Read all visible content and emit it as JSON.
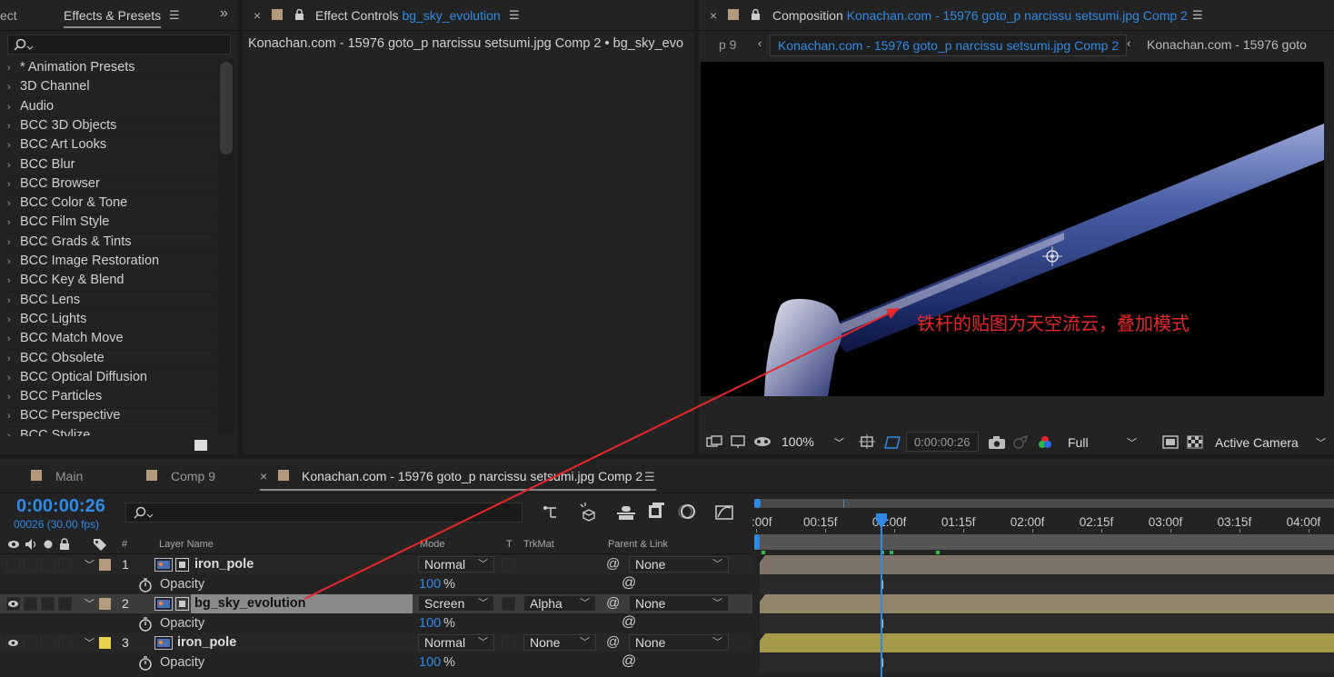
{
  "effects_panel": {
    "clipped_tab": "ect",
    "tab_title": "Effects & Presets",
    "search_placeholder": "",
    "items": [
      "* Animation Presets",
      "3D Channel",
      "Audio",
      "BCC 3D Objects",
      "BCC Art Looks",
      "BCC Blur",
      "BCC Browser",
      "BCC Color & Tone",
      "BCC Film Style",
      "BCC Grads & Tints",
      "BCC Image Restoration",
      "BCC Key & Blend",
      "BCC Lens",
      "BCC Lights",
      "BCC Match Move",
      "BCC Obsolete",
      "BCC Optical Diffusion",
      "BCC Particles",
      "BCC Perspective",
      "BCC Stylize"
    ]
  },
  "effect_controls": {
    "tab_prefix": "Effect Controls",
    "tab_layer": "bg_sky_evolution",
    "breadcrumb": "Konachan.com - 15976 goto_p narcissu setsumi.jpg Comp 2 • bg_sky_evo"
  },
  "composition": {
    "tab_prefix": "Composition",
    "tab_comp": "Konachan.com - 15976 goto_p narcissu setsumi.jpg Comp 2",
    "nav_prev": "p 9",
    "nav_active": "Konachan.com - 15976 goto_p narcissu setsumi.jpg Comp 2",
    "nav_next": "Konachan.com - 15976 goto",
    "annotation": "铁杆的贴图为天空流云，叠加模式",
    "zoom": "100%",
    "timecode": "0:00:00:26",
    "resolution": "Full",
    "camera": "Active Camera"
  },
  "timeline": {
    "tabs": [
      "Main",
      "Comp 9",
      "Konachan.com - 15976 goto_p narcissu setsumi.jpg Comp 2"
    ],
    "current_time": "0:00:00:26",
    "frame_info": "00026 (30.00 fps)",
    "columns": {
      "hash": "#",
      "layer_name": "Layer Name",
      "mode": "Mode",
      "t": "T",
      "trkmat": "TrkMat",
      "parent": "Parent & Link"
    },
    "ruler": [
      ":00f",
      "00:15f",
      "01:00f",
      "01:15f",
      "02:00f",
      "02:15f",
      "03:00f",
      "03:15f",
      "04:00f"
    ],
    "playhead_fraction": 0.22,
    "layers": [
      {
        "num": "1",
        "name": "iron_pole",
        "mode": "Normal",
        "trkmat": "",
        "parent": "None",
        "label_color": "#b49b7d",
        "visible": false,
        "prop": "Opacity",
        "prop_value": "100",
        "unit": "%"
      },
      {
        "num": "2",
        "name": "bg_sky_evolution",
        "mode": "Screen",
        "trkmat": "Alpha",
        "parent": "None",
        "label_color": "#b49b7d",
        "visible": true,
        "prop": "Opacity",
        "prop_value": "100",
        "unit": "%"
      },
      {
        "num": "3",
        "name": "iron_pole",
        "mode": "Normal",
        "trkmat": "None",
        "parent": "None",
        "label_color": "#e8d24a",
        "visible": true,
        "prop": "Opacity",
        "prop_value": "100",
        "unit": "%"
      }
    ]
  },
  "colors": {
    "accent": "#2f8ae6",
    "annotation": "#e8272b",
    "bar1": "#7d7266",
    "bar2": "#8f8468",
    "bar3": "#a49a4a"
  }
}
